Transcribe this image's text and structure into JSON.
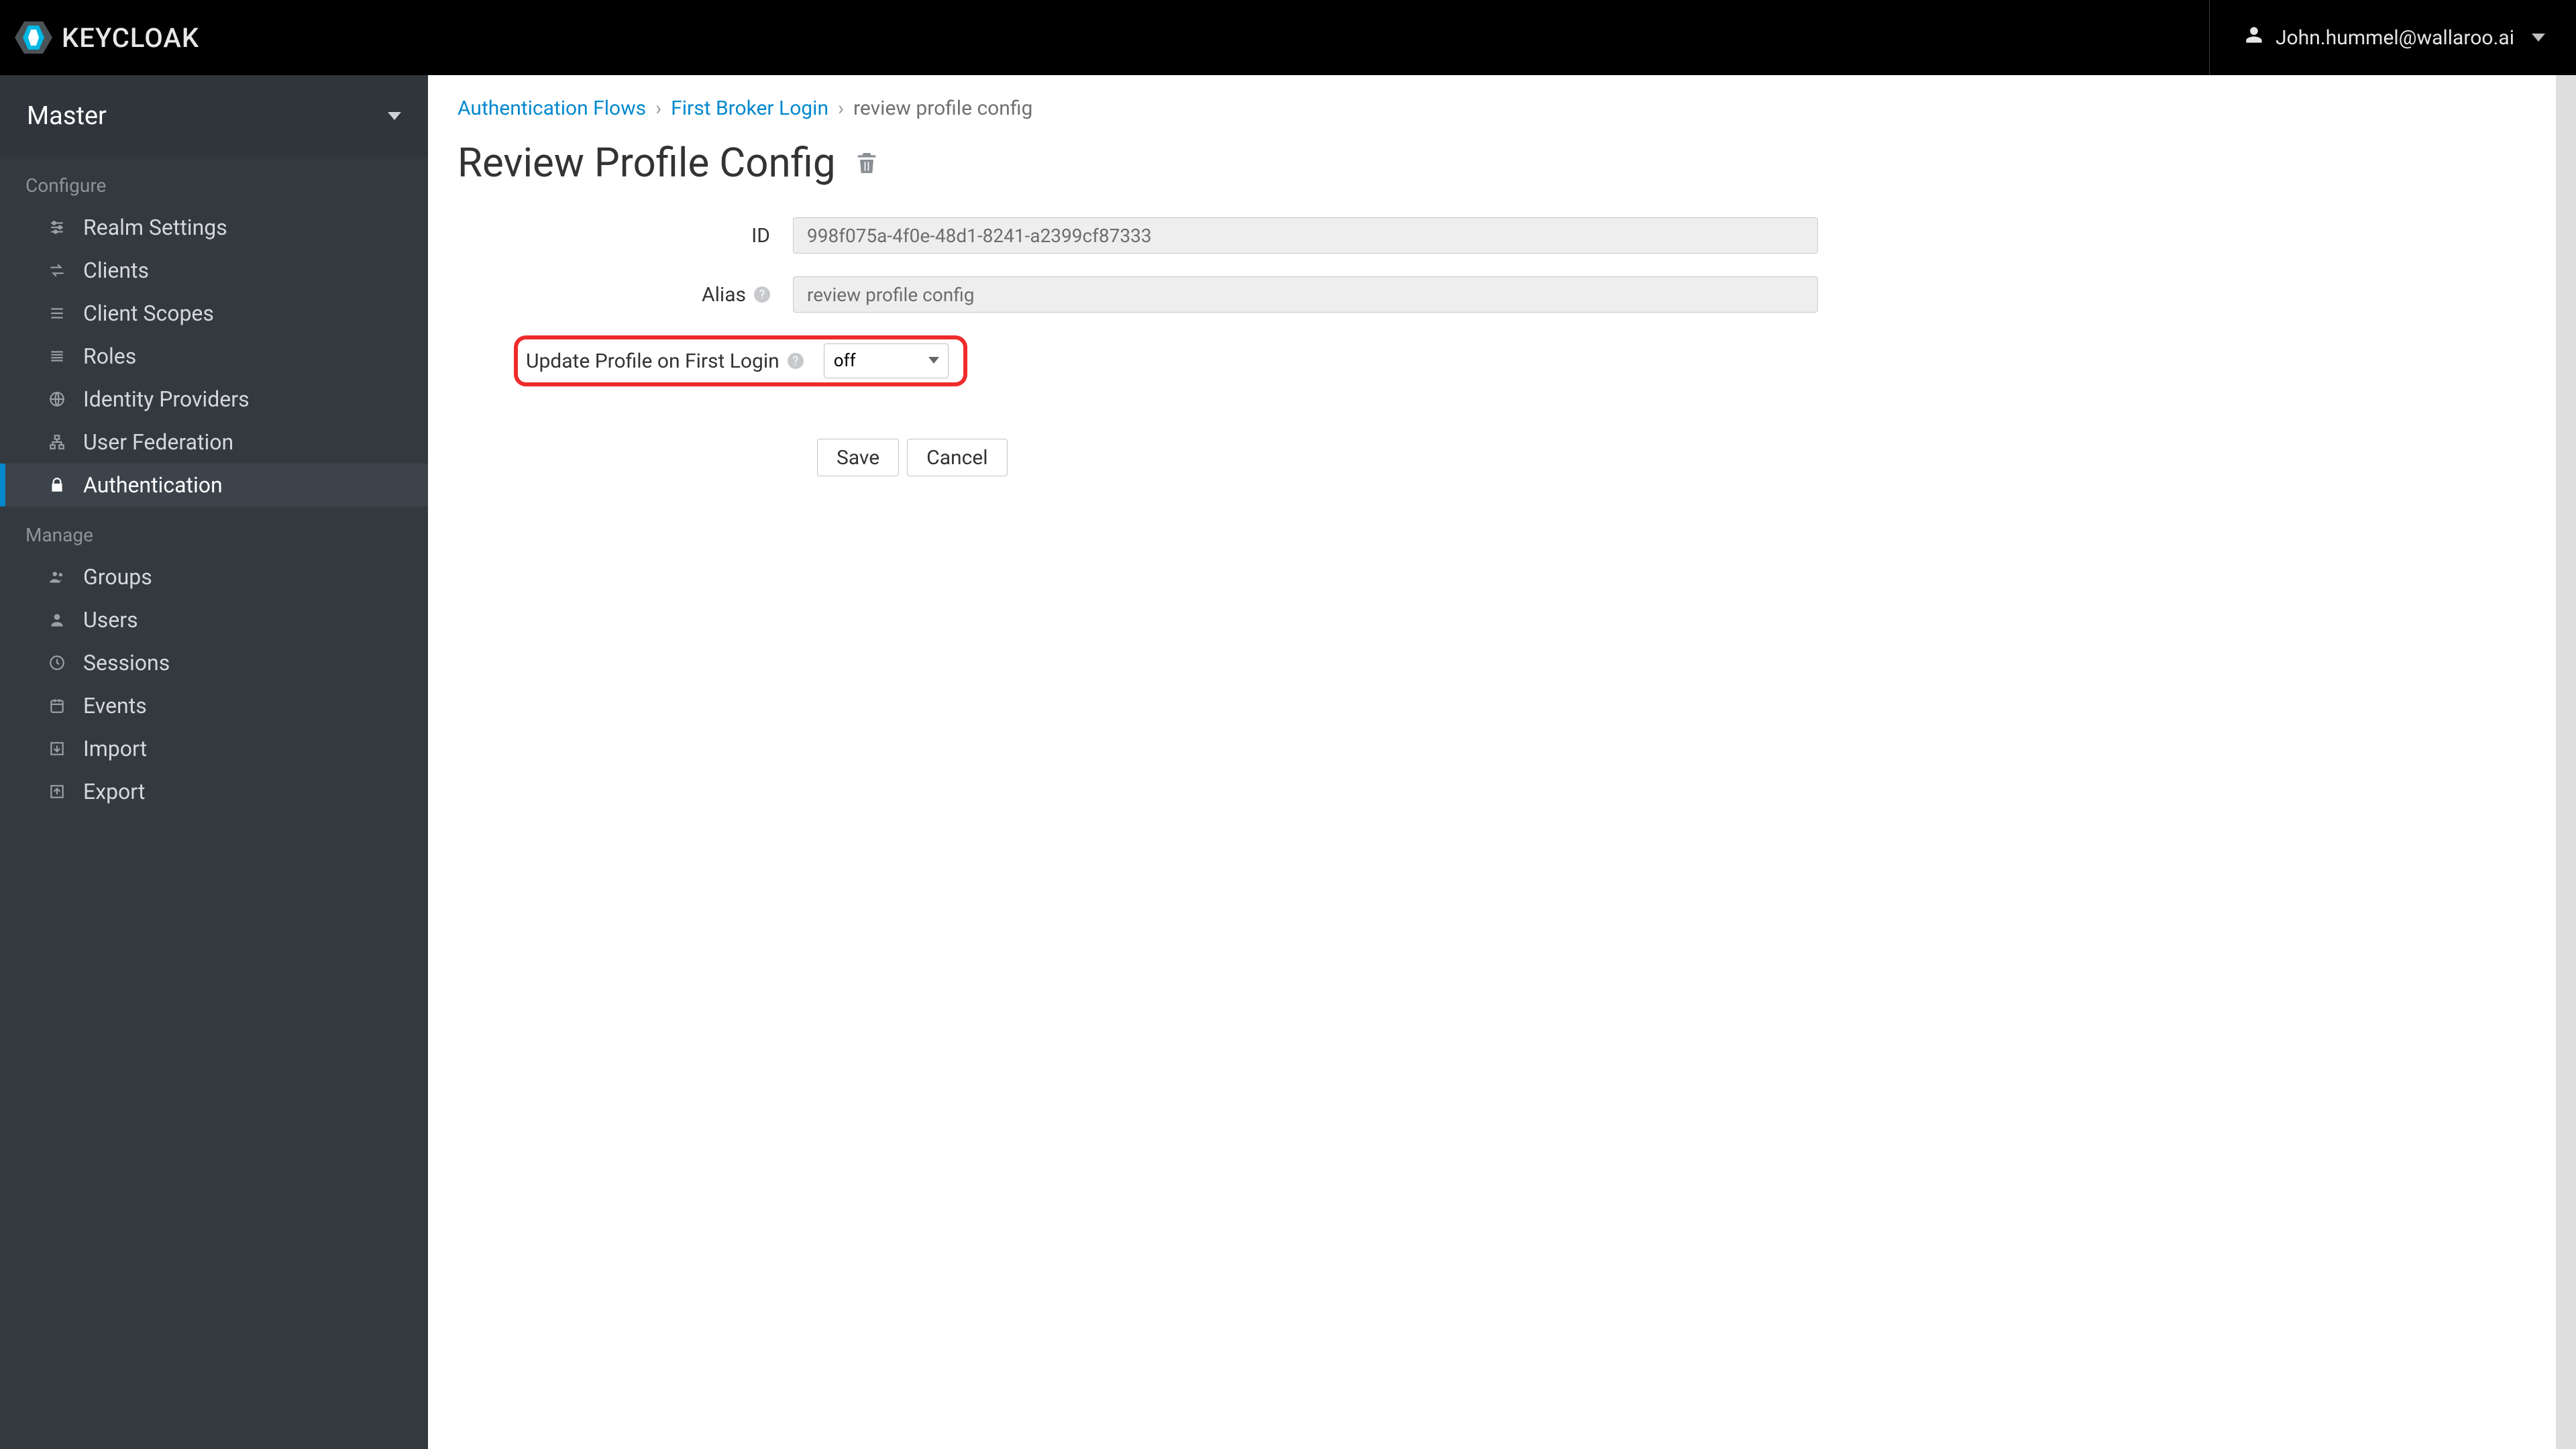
{
  "brand": {
    "name": "KEYCLOAK"
  },
  "user": {
    "display": "John.hummel@wallaroo.ai"
  },
  "realmSelector": {
    "label": "Master"
  },
  "sidebar": {
    "groups": [
      {
        "label": "Configure",
        "items": [
          {
            "label": "Realm Settings",
            "icon": "sliders"
          },
          {
            "label": "Clients",
            "icon": "swap"
          },
          {
            "label": "Client Scopes",
            "icon": "list"
          },
          {
            "label": "Roles",
            "icon": "stack"
          },
          {
            "label": "Identity Providers",
            "icon": "globe"
          },
          {
            "label": "User Federation",
            "icon": "sitemap"
          },
          {
            "label": "Authentication",
            "icon": "lock",
            "active": true
          }
        ]
      },
      {
        "label": "Manage",
        "items": [
          {
            "label": "Groups",
            "icon": "users"
          },
          {
            "label": "Users",
            "icon": "user"
          },
          {
            "label": "Sessions",
            "icon": "clock"
          },
          {
            "label": "Events",
            "icon": "calendar"
          },
          {
            "label": "Import",
            "icon": "import"
          },
          {
            "label": "Export",
            "icon": "export"
          }
        ]
      }
    ]
  },
  "breadcrumbs": {
    "a": "Authentication Flows",
    "b": "First Broker Login",
    "c": "review profile config"
  },
  "page": {
    "title": "Review Profile Config"
  },
  "form": {
    "id_label": "ID",
    "id_value": "998f075a-4f0e-48d1-8241-a2399cf87333",
    "alias_label": "Alias",
    "alias_value": "review profile config",
    "update_label": "Update Profile on First Login",
    "update_value": "off",
    "save": "Save",
    "cancel": "Cancel"
  }
}
